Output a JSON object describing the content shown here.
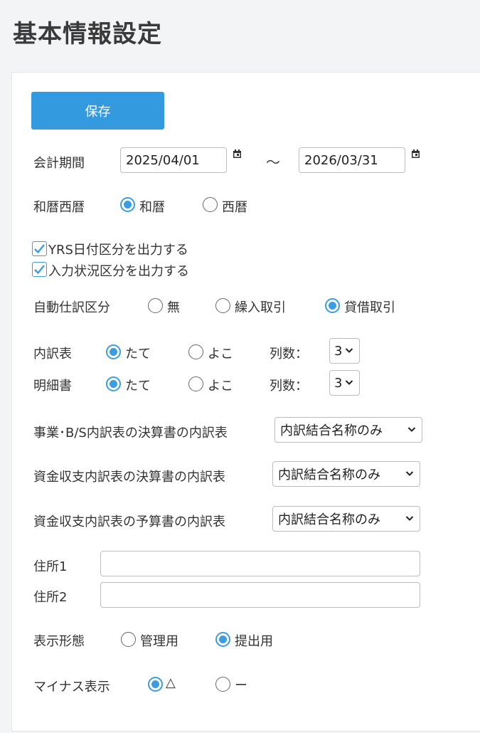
{
  "page": {
    "title": "基本情報設定"
  },
  "toolbar": {
    "save_label": "保存"
  },
  "period": {
    "label": "会計期間",
    "start": "2025/04/01",
    "separator": "～",
    "end": "2026/03/31"
  },
  "era": {
    "label": "和暦西暦",
    "options": [
      "和暦",
      "西暦"
    ],
    "selected": "和暦"
  },
  "checkboxes": [
    {
      "label": "YRS日付区分を出力する",
      "checked": true
    },
    {
      "label": "入力状況区分を出力する",
      "checked": true
    }
  ],
  "auto_journal": {
    "label": "自動仕訳区分",
    "options": [
      "無",
      "繰入取引",
      "貸借取引"
    ],
    "selected": "貸借取引"
  },
  "breakdown": {
    "label": "内訳表",
    "options": [
      "たて",
      "よこ"
    ],
    "selected": "たて",
    "columns_label": "列数：",
    "columns_value": "3"
  },
  "detail": {
    "label": "明細書",
    "options": [
      "たて",
      "よこ"
    ],
    "selected": "たて",
    "columns_label": "列数：",
    "columns_value": "3"
  },
  "selects": [
    {
      "label": "事業･B/S内訳表の決算書の内訳表",
      "value": "内訳結合名称のみ"
    },
    {
      "label": "資金収支内訳表の決算書の内訳表",
      "value": "内訳結合名称のみ"
    },
    {
      "label": "資金収支内訳表の予算書の内訳表",
      "value": "内訳結合名称のみ"
    }
  ],
  "address": {
    "label1": "住所1",
    "value1": "",
    "label2": "住所2",
    "value2": ""
  },
  "display_mode": {
    "label": "表示形態",
    "options": [
      "管理用",
      "提出用"
    ],
    "selected": "提出用"
  },
  "minus_display": {
    "label": "マイナス表示",
    "options": [
      "△",
      "ー"
    ],
    "selected": "△"
  },
  "colors": {
    "accent": "#349ae0",
    "background": "#f3f4f6"
  },
  "icons": {
    "calendar": "calendar-icon",
    "chevron": "chevron-down-icon",
    "check": "checkmark-icon"
  }
}
